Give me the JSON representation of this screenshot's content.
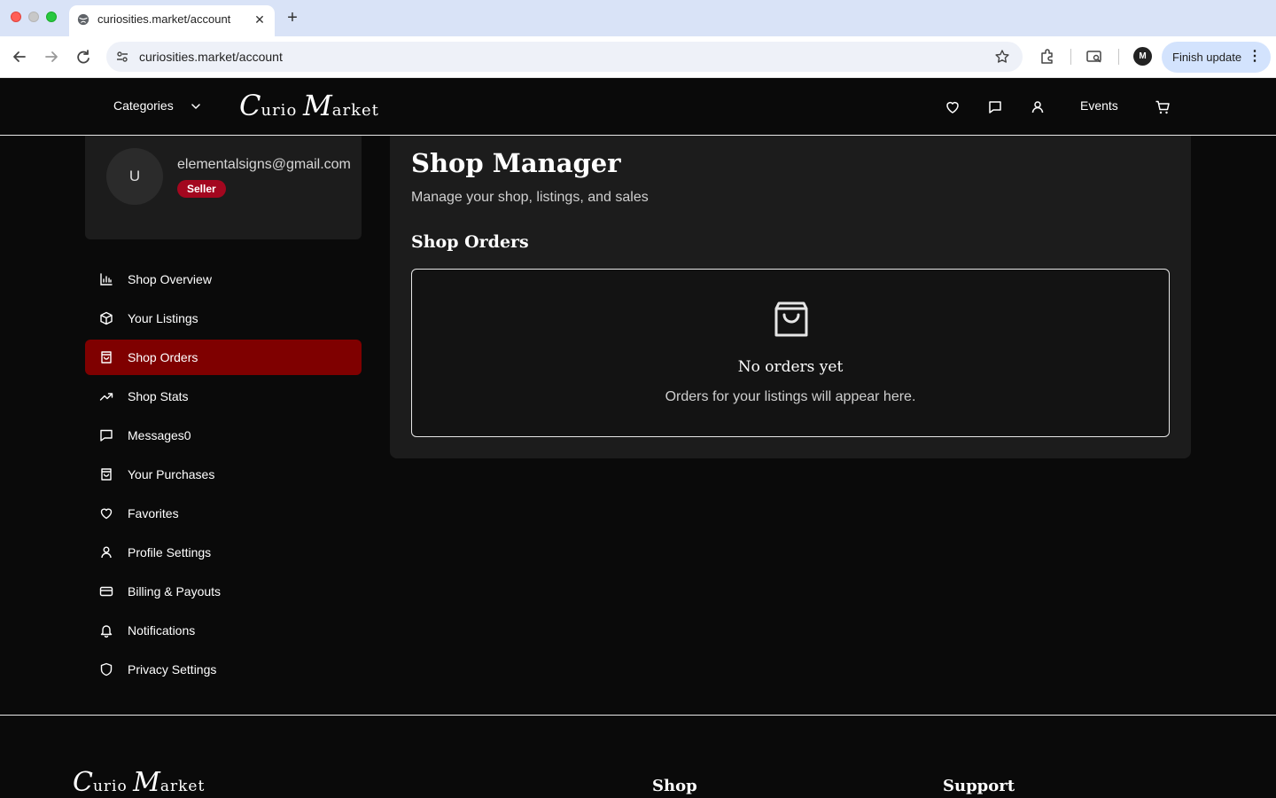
{
  "browser": {
    "tab_title": "curiosities.market/account",
    "tab_close": "✕",
    "new_tab": "+",
    "url": "curiosities.market/account",
    "profile_initials": "M",
    "finish_update_label": "Finish update",
    "menu_glyph": "⋮"
  },
  "header": {
    "categories_label": "Categories",
    "logo_letters": [
      "C",
      "urio ",
      "M",
      "arket"
    ],
    "events_label": "Events",
    "icons": [
      "heart-icon",
      "message-icon",
      "user-icon",
      "cart-icon"
    ]
  },
  "profile": {
    "avatar_letter": "U",
    "email": "elementalsigns@gmail.com",
    "role_badge": "Seller"
  },
  "sidebar": {
    "items": [
      {
        "label": "Shop Overview",
        "icon": "bar-chart-icon",
        "active": false
      },
      {
        "label": "Your Listings",
        "icon": "package-icon",
        "active": false
      },
      {
        "label": "Shop Orders",
        "icon": "shopping-bag-icon",
        "active": true
      },
      {
        "label": "Shop Stats",
        "icon": "trending-up-icon",
        "active": false
      },
      {
        "label": "Messages0",
        "icon": "message-icon",
        "active": false
      },
      {
        "label": "Your Purchases",
        "icon": "shopping-bag-icon",
        "active": false
      },
      {
        "label": "Favorites",
        "icon": "heart-icon",
        "active": false
      },
      {
        "label": "Profile Settings",
        "icon": "user-icon",
        "active": false
      },
      {
        "label": "Billing & Payouts",
        "icon": "credit-card-icon",
        "active": false
      },
      {
        "label": "Notifications",
        "icon": "bell-icon",
        "active": false
      },
      {
        "label": "Privacy Settings",
        "icon": "shield-icon",
        "active": false
      }
    ]
  },
  "main": {
    "title": "Shop Manager",
    "subtitle": "Manage your shop, listings, and sales",
    "section_title": "Shop Orders",
    "empty_state": {
      "icon": "shopping-bag-icon",
      "title": "No orders yet",
      "text": "Orders for your listings will appear here."
    }
  },
  "footer": {
    "columns": [
      "Shop",
      "Support"
    ]
  },
  "colors": {
    "accent_active": "#7f0000",
    "badge": "#a3071f",
    "background": "#0a0a0a",
    "panel": "#1c1c1c"
  }
}
